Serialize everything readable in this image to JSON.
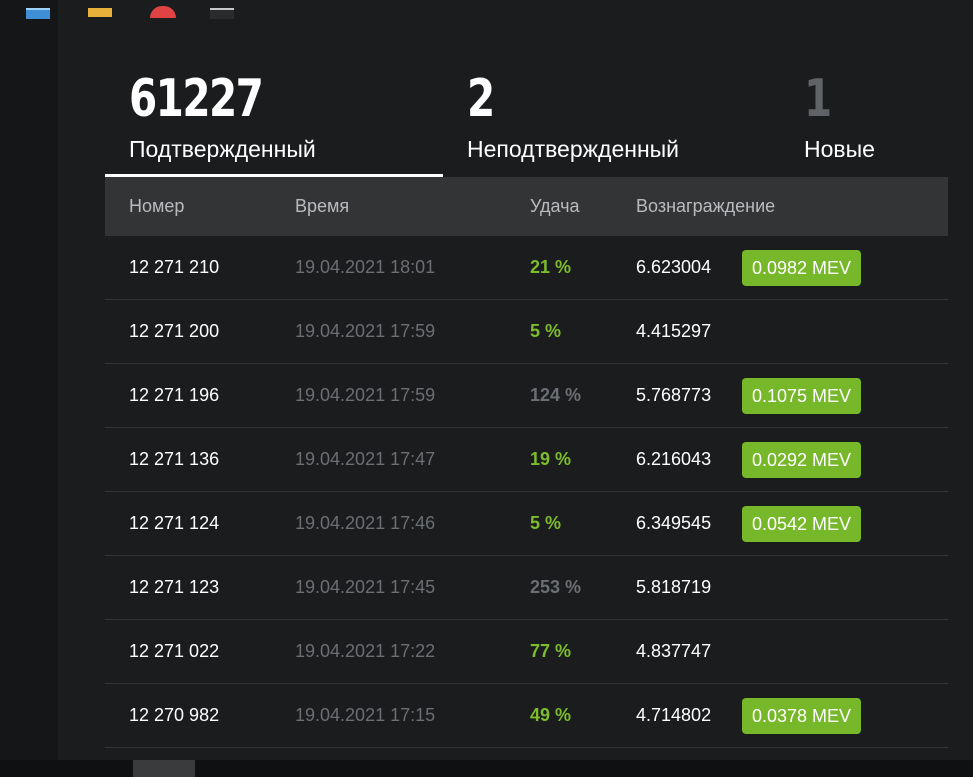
{
  "stats": [
    {
      "value": "61227",
      "label": "Подтвержденный",
      "active": true
    },
    {
      "value": "2",
      "label": "Неподтвержденный",
      "active": false
    },
    {
      "value": "1",
      "label": "Новые",
      "active": false
    }
  ],
  "table": {
    "headers": {
      "number": "Номер",
      "time": "Время",
      "luck": "Удача",
      "reward": "Вознаграждение"
    },
    "rows": [
      {
        "number": "12 271 210",
        "time": "19.04.2021 18:01",
        "luck": "21 %",
        "luck_status": "good",
        "reward": "6.623004",
        "mev": "0.0982 MEV"
      },
      {
        "number": "12 271 200",
        "time": "19.04.2021 17:59",
        "luck": "5 %",
        "luck_status": "good",
        "reward": "4.415297",
        "mev": ""
      },
      {
        "number": "12 271 196",
        "time": "19.04.2021 17:59",
        "luck": "124 %",
        "luck_status": "bad",
        "reward": "5.768773",
        "mev": "0.1075 MEV"
      },
      {
        "number": "12 271 136",
        "time": "19.04.2021 17:47",
        "luck": "19 %",
        "luck_status": "good",
        "reward": "6.216043",
        "mev": "0.0292 MEV"
      },
      {
        "number": "12 271 124",
        "time": "19.04.2021 17:46",
        "luck": "5 %",
        "luck_status": "good",
        "reward": "6.349545",
        "mev": "0.0542 MEV"
      },
      {
        "number": "12 271 123",
        "time": "19.04.2021 17:45",
        "luck": "253 %",
        "luck_status": "bad",
        "reward": "5.818719",
        "mev": ""
      },
      {
        "number": "12 271 022",
        "time": "19.04.2021 17:22",
        "luck": "77 %",
        "luck_status": "good",
        "reward": "4.837747",
        "mev": ""
      },
      {
        "number": "12 270 982",
        "time": "19.04.2021 17:15",
        "luck": "49 %",
        "luck_status": "good",
        "reward": "4.714802",
        "mev": "0.0378 MEV"
      }
    ]
  },
  "colors": {
    "accent_green": "#77b82a",
    "luck_good": "#7cbd2b",
    "muted": "#6b6e72",
    "header_bg": "#323436",
    "background": "#1b1c1e"
  },
  "taskbar": {
    "icons": [
      "monitor-icon",
      "folder-icon",
      "browser-icon",
      "terminal-icon"
    ]
  }
}
